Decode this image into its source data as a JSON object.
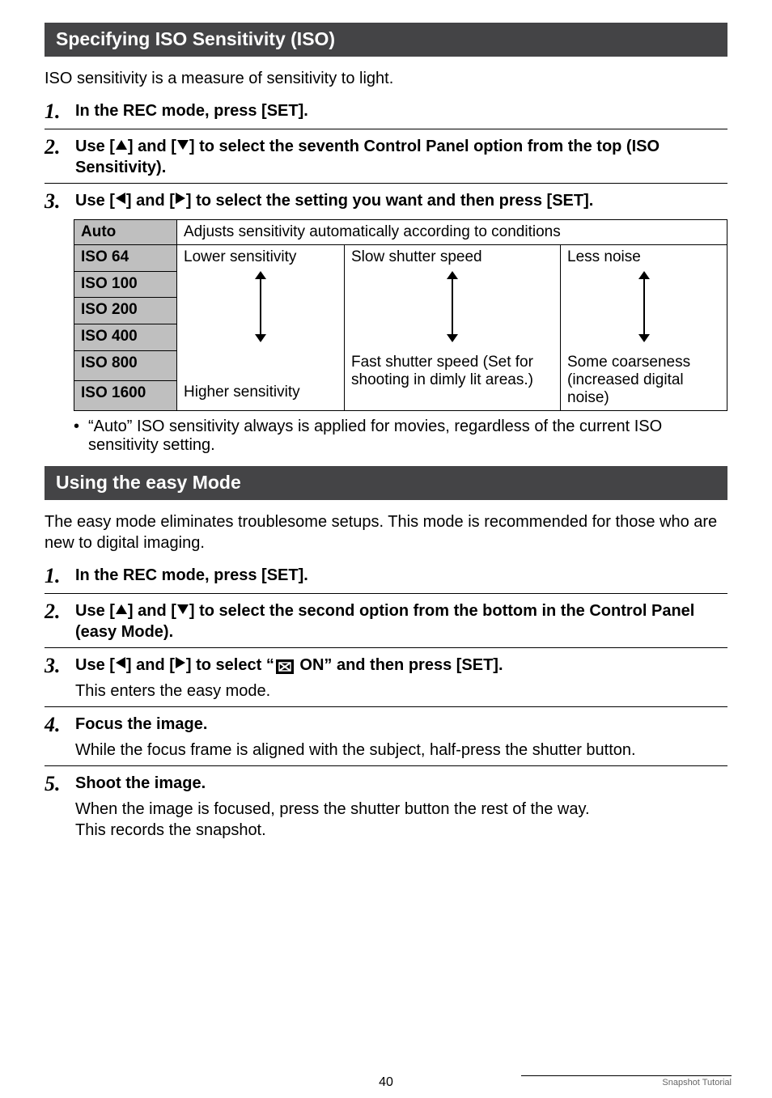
{
  "section1": {
    "title": "Specifying ISO Sensitivity (ISO)",
    "intro": "ISO sensitivity is a measure of sensitivity to light.",
    "steps": [
      {
        "num": "1.",
        "title_pre": "In the REC mode, press [SET]."
      },
      {
        "num": "2.",
        "title_pre": "Use [",
        "title_mid": "] and [",
        "title_post": "] to select the seventh Control Panel option from the top (ISO Sensitivity)."
      },
      {
        "num": "3.",
        "title_pre": "Use [",
        "title_mid": "] and [",
        "title_post": "] to select the setting you want and then press [SET]."
      }
    ],
    "table": {
      "rows": [
        "Auto",
        "ISO 64",
        "ISO 100",
        "ISO 200",
        "ISO 400",
        "ISO 800",
        "ISO 1600"
      ],
      "auto_desc": "Adjusts sensitivity automatically according to conditions",
      "col1_top": "Lower sensitivity",
      "col1_bottom": "Higher sensitivity",
      "col2_top": "Slow shutter speed",
      "col2_bottom": "Fast shutter speed (Set for shooting in dimly lit areas.)",
      "col3_top": "Less noise",
      "col3_bottom": "Some coarseness (increased digital noise)"
    },
    "note": "“Auto” ISO sensitivity always is applied for movies, regardless of the current ISO sensitivity setting."
  },
  "section2": {
    "title": "Using the easy Mode",
    "intro": "The easy mode eliminates troublesome setups. This mode is recommended for those who are new to digital imaging.",
    "steps": [
      {
        "num": "1.",
        "title": "In the REC mode, press [SET]."
      },
      {
        "num": "2.",
        "title_pre": "Use [",
        "title_mid": "] and [",
        "title_post": "] to select the second option from the bottom in the Control Panel (easy Mode)."
      },
      {
        "num": "3.",
        "title_pre": "Use [",
        "title_mid": "] and [",
        "title_post1": "] to select “",
        "title_post2": " ON” and then press [SET].",
        "text": "This enters the easy mode."
      },
      {
        "num": "4.",
        "title": "Focus the image.",
        "text": "While the focus frame is aligned with the subject, half-press the shutter button."
      },
      {
        "num": "5.",
        "title": "Shoot the image.",
        "text": "When the image is focused, press the shutter button the rest of the way.\nThis records the snapshot."
      }
    ]
  },
  "footer": {
    "page": "40",
    "right": "Snapshot Tutorial"
  }
}
